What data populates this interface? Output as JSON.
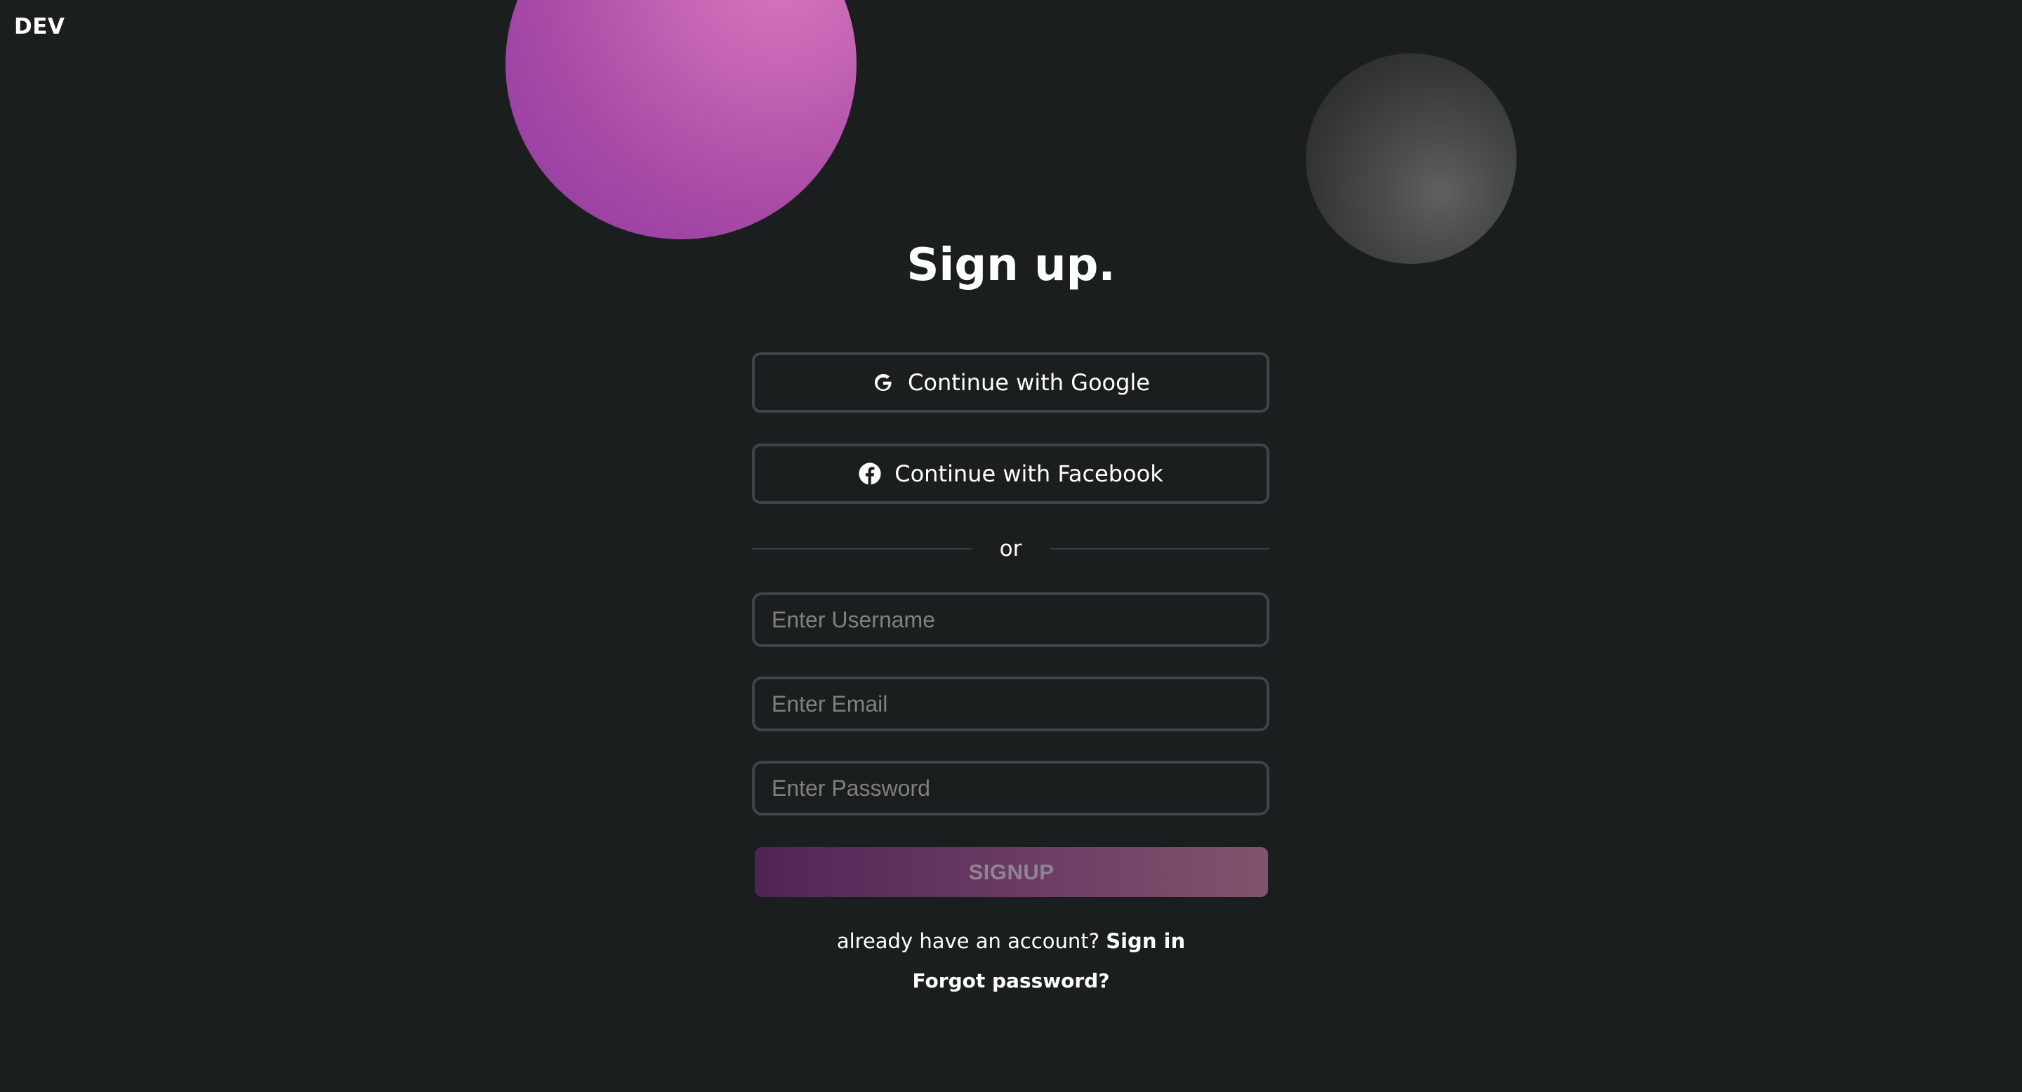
{
  "brand": {
    "label": "DEV"
  },
  "colors": {
    "background": "#1b1e1f",
    "border": "#414446",
    "accent_pink": "#d975bd",
    "accent_purple": "#8d3aa0",
    "signup_gradient_start": "#4f2456",
    "signup_gradient_end": "#82536c"
  },
  "page": {
    "title": "Sign up."
  },
  "social": {
    "google": {
      "label": "Continue with Google",
      "icon": "google-icon"
    },
    "facebook": {
      "label": "Continue with Facebook",
      "icon": "facebook-icon"
    }
  },
  "divider": {
    "label": "or"
  },
  "form": {
    "username": {
      "placeholder": "Enter Username",
      "value": ""
    },
    "email": {
      "placeholder": "Enter Email",
      "value": ""
    },
    "password": {
      "placeholder": "Enter Password",
      "value": ""
    },
    "submit_label": "SIGNUP"
  },
  "footer": {
    "account_prompt": "already have an account?",
    "signin_label": "Sign in",
    "forgot_label": "Forgot password?"
  }
}
